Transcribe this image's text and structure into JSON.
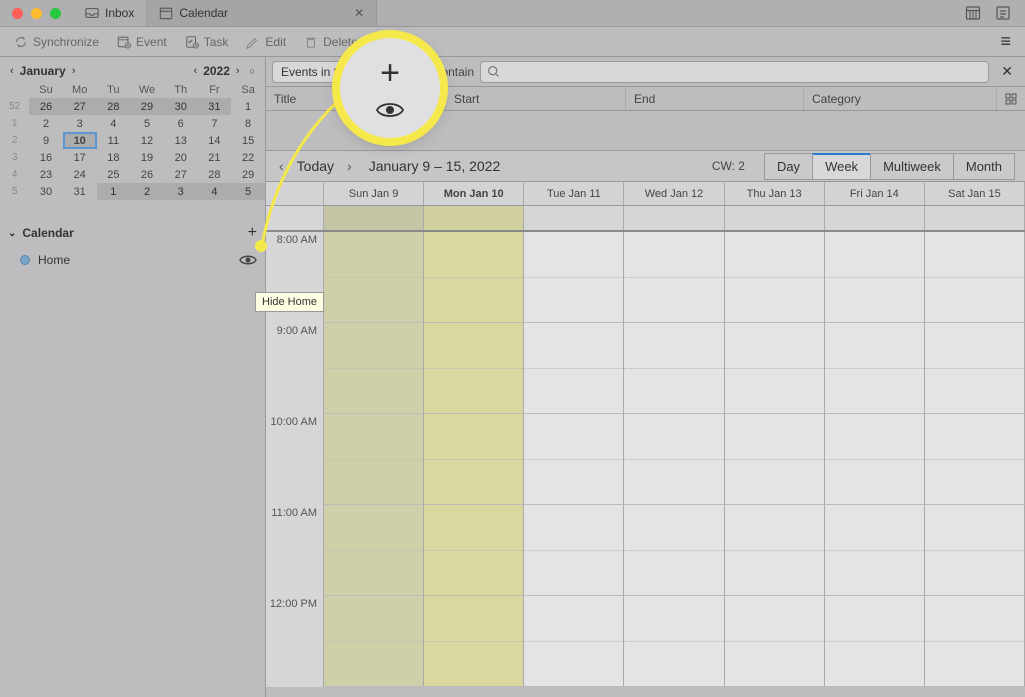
{
  "tabs": {
    "inbox": "Inbox",
    "calendar": "Calendar"
  },
  "toolbar": {
    "sync": "Synchronize",
    "event": "Event",
    "task": "Task",
    "edit": "Edit",
    "delete": "Delete"
  },
  "minical": {
    "month": "January",
    "year": "2022",
    "weekdays": [
      "Su",
      "Mo",
      "Tu",
      "We",
      "Th",
      "Fr",
      "Sa"
    ],
    "weeks": [
      {
        "wk": "52",
        "days": [
          {
            "d": "26",
            "t": "prev"
          },
          {
            "d": "27",
            "t": "prev"
          },
          {
            "d": "28",
            "t": "prev"
          },
          {
            "d": "29",
            "t": "prev"
          },
          {
            "d": "30",
            "t": "prev"
          },
          {
            "d": "31",
            "t": "prev"
          },
          {
            "d": "1",
            "t": ""
          }
        ]
      },
      {
        "wk": "1",
        "days": [
          {
            "d": "2",
            "t": ""
          },
          {
            "d": "3",
            "t": ""
          },
          {
            "d": "4",
            "t": ""
          },
          {
            "d": "5",
            "t": ""
          },
          {
            "d": "6",
            "t": ""
          },
          {
            "d": "7",
            "t": ""
          },
          {
            "d": "8",
            "t": ""
          }
        ]
      },
      {
        "wk": "2",
        "days": [
          {
            "d": "9",
            "t": ""
          },
          {
            "d": "10",
            "t": "today"
          },
          {
            "d": "11",
            "t": ""
          },
          {
            "d": "12",
            "t": ""
          },
          {
            "d": "13",
            "t": ""
          },
          {
            "d": "14",
            "t": ""
          },
          {
            "d": "15",
            "t": ""
          }
        ]
      },
      {
        "wk": "3",
        "days": [
          {
            "d": "16",
            "t": ""
          },
          {
            "d": "17",
            "t": ""
          },
          {
            "d": "18",
            "t": ""
          },
          {
            "d": "19",
            "t": ""
          },
          {
            "d": "20",
            "t": ""
          },
          {
            "d": "21",
            "t": ""
          },
          {
            "d": "22",
            "t": ""
          }
        ]
      },
      {
        "wk": "4",
        "days": [
          {
            "d": "23",
            "t": ""
          },
          {
            "d": "24",
            "t": ""
          },
          {
            "d": "25",
            "t": ""
          },
          {
            "d": "26",
            "t": ""
          },
          {
            "d": "27",
            "t": ""
          },
          {
            "d": "28",
            "t": ""
          },
          {
            "d": "29",
            "t": ""
          }
        ]
      },
      {
        "wk": "5",
        "days": [
          {
            "d": "30",
            "t": ""
          },
          {
            "d": "31",
            "t": ""
          },
          {
            "d": "1",
            "t": "next"
          },
          {
            "d": "2",
            "t": "next"
          },
          {
            "d": "3",
            "t": "next"
          },
          {
            "d": "4",
            "t": "next"
          },
          {
            "d": "5",
            "t": "next"
          }
        ]
      }
    ]
  },
  "calendar_section": {
    "title": "Calendar",
    "items": [
      {
        "name": "Home"
      }
    ]
  },
  "tooltip": "Hide Home",
  "filter": {
    "scope": "Events in the",
    "op": "contain"
  },
  "events_cols": {
    "title": "Title",
    "start": "Start",
    "end": "End",
    "category": "Category"
  },
  "weeknav": {
    "today": "Today",
    "range": "January 9 – 15, 2022",
    "cw": "CW: 2",
    "views": {
      "day": "Day",
      "week": "Week",
      "multiweek": "Multiweek",
      "month": "Month"
    }
  },
  "days": [
    "Sun Jan 9",
    "Mon Jan 10",
    "Tue Jan 11",
    "Wed Jan 12",
    "Thu Jan 13",
    "Fri Jan 14",
    "Sat Jan 15"
  ],
  "today_index": 1,
  "hours": [
    "8:00 AM",
    "9:00 AM",
    "10:00 AM",
    "11:00 AM",
    "12:00 PM"
  ]
}
